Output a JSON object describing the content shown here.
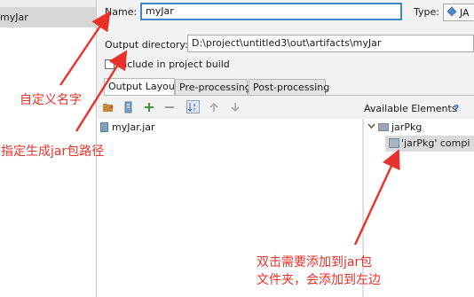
{
  "artifacts_list": {
    "selected_item": "myJar"
  },
  "form": {
    "name_label": "Name:",
    "name_value": "myJar",
    "type_label": "Type:",
    "type_value": "JA",
    "output_dir_label": "Output directory:",
    "output_dir_value": "D:\\project\\untitled3\\out\\artifacts\\myJar",
    "include_label": "Include in project build",
    "include_checked": false
  },
  "tabs": [
    {
      "label": "Output Layout",
      "active": true
    },
    {
      "label": "Pre-processing",
      "active": false
    },
    {
      "label": "Post-processing",
      "active": false
    }
  ],
  "toolbar": {
    "icons": [
      "folder-add-icon",
      "jar-add-icon",
      "add-icon",
      "remove-icon",
      "sort-icon",
      "move-up-icon",
      "move-down-icon"
    ]
  },
  "output_tree": [
    {
      "label": "myJar.jar",
      "icon": "jar-icon"
    }
  ],
  "available": {
    "header": "Available Elements",
    "help": "?",
    "tree": [
      {
        "label": "jarPkg",
        "icon": "folder-icon",
        "expanded": true
      },
      {
        "label": "'jarPkg' compi",
        "icon": "module-icon",
        "selected": true
      }
    ]
  },
  "annotations": {
    "name_note": "自定义名字",
    "path_note": "指定生成jar包路径",
    "double_click_line1": "双击需要添加到jar包",
    "double_click_line2": "文件夹，会添加到左边",
    "color": "#e8312a"
  }
}
